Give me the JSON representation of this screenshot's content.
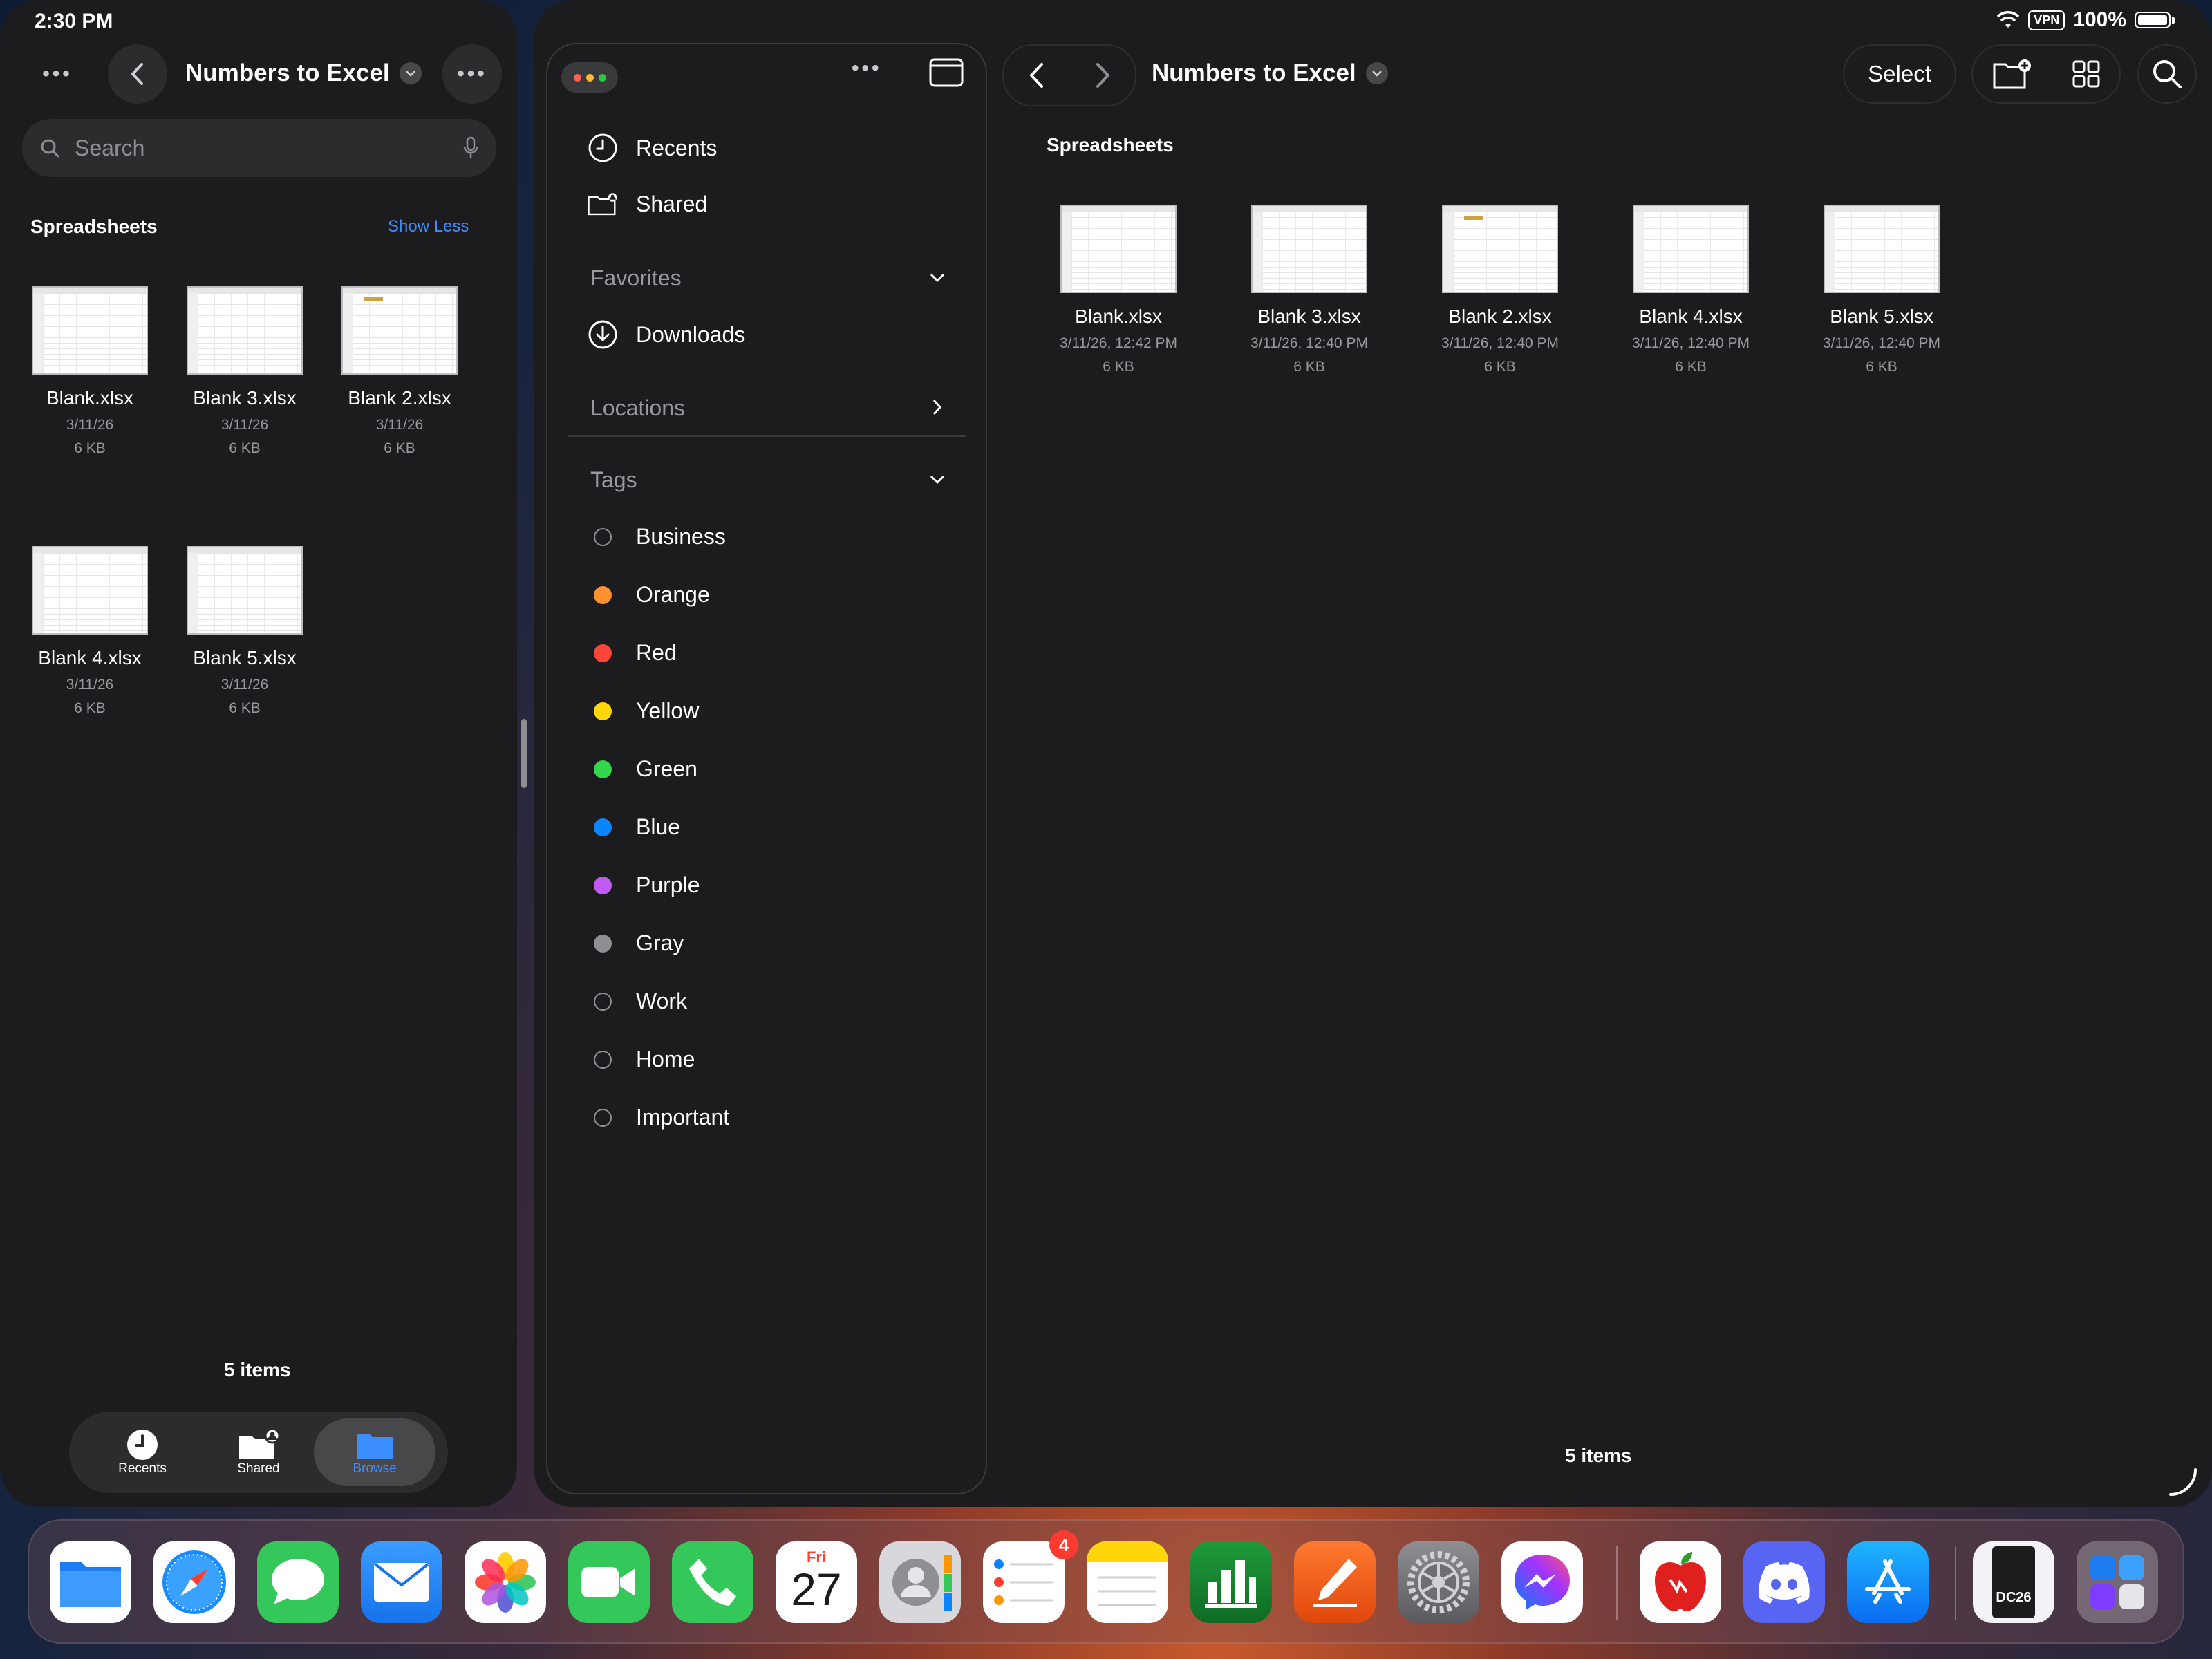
{
  "status": {
    "time": "2:30 PM",
    "vpn": "VPN",
    "battery": "100%"
  },
  "left_window": {
    "title": "Numbers to Excel",
    "search_placeholder": "Search",
    "section_title": "Spreadsheets",
    "show_less": "Show Less",
    "files": [
      {
        "name": "Blank.xlsx",
        "date": "3/11/26",
        "size": "6 KB"
      },
      {
        "name": "Blank 3.xlsx",
        "date": "3/11/26",
        "size": "6 KB"
      },
      {
        "name": "Blank 2.xlsx",
        "date": "3/11/26",
        "size": "6 KB"
      },
      {
        "name": "Blank 4.xlsx",
        "date": "3/11/26",
        "size": "6 KB"
      },
      {
        "name": "Blank 5.xlsx",
        "date": "3/11/26",
        "size": "6 KB"
      }
    ],
    "item_count": "5 items",
    "tabs": [
      {
        "label": "Recents",
        "icon": "clock-icon",
        "active": false
      },
      {
        "label": "Shared",
        "icon": "shared-folder-icon",
        "active": false
      },
      {
        "label": "Browse",
        "icon": "folder-icon",
        "active": true
      }
    ]
  },
  "sidebar": {
    "top_items": [
      {
        "label": "Recents",
        "icon": "clock-icon"
      },
      {
        "label": "Shared",
        "icon": "shared-folder-icon"
      }
    ],
    "favorites_label": "Favorites",
    "favorites": [
      {
        "label": "Downloads",
        "icon": "download-icon"
      }
    ],
    "locations_label": "Locations",
    "tags_label": "Tags",
    "tags": [
      {
        "label": "Business",
        "color": null
      },
      {
        "label": "Orange",
        "color": "#ff9230"
      },
      {
        "label": "Red",
        "color": "#ff453a"
      },
      {
        "label": "Yellow",
        "color": "#ffd60a"
      },
      {
        "label": "Green",
        "color": "#32d74b"
      },
      {
        "label": "Blue",
        "color": "#0a84ff"
      },
      {
        "label": "Purple",
        "color": "#bf5af2"
      },
      {
        "label": "Gray",
        "color": "#8e8e93"
      },
      {
        "label": "Work",
        "color": null
      },
      {
        "label": "Home",
        "color": null
      },
      {
        "label": "Important",
        "color": null
      }
    ]
  },
  "main": {
    "title": "Numbers to Excel",
    "select_label": "Select",
    "section_title": "Spreadsheets",
    "files": [
      {
        "name": "Blank.xlsx",
        "date": "3/11/26, 12:42 PM",
        "size": "6 KB"
      },
      {
        "name": "Blank 3.xlsx",
        "date": "3/11/26, 12:40 PM",
        "size": "6 KB"
      },
      {
        "name": "Blank 2.xlsx",
        "date": "3/11/26, 12:40 PM",
        "size": "6 KB"
      },
      {
        "name": "Blank 4.xlsx",
        "date": "3/11/26, 12:40 PM",
        "size": "6 KB"
      },
      {
        "name": "Blank 5.xlsx",
        "date": "3/11/26, 12:40 PM",
        "size": "6 KB"
      }
    ],
    "item_count": "5 items"
  },
  "dock": {
    "apps": [
      "files-app",
      "safari-app",
      "messages-app",
      "mail-app",
      "photos-app",
      "facetime-app",
      "phone-app",
      "calendar-app",
      "contacts-app",
      "reminders-app",
      "notes-app",
      "numbers-app",
      "pages-app",
      "settings-app",
      "messenger-app",
      "apple-app",
      "discord-app",
      "app-store-app",
      "dc26-app",
      "app-library"
    ],
    "calendar_day": "Fri",
    "calendar_date": "27",
    "reminders_badge": "4",
    "dc26_label": "DC26"
  }
}
